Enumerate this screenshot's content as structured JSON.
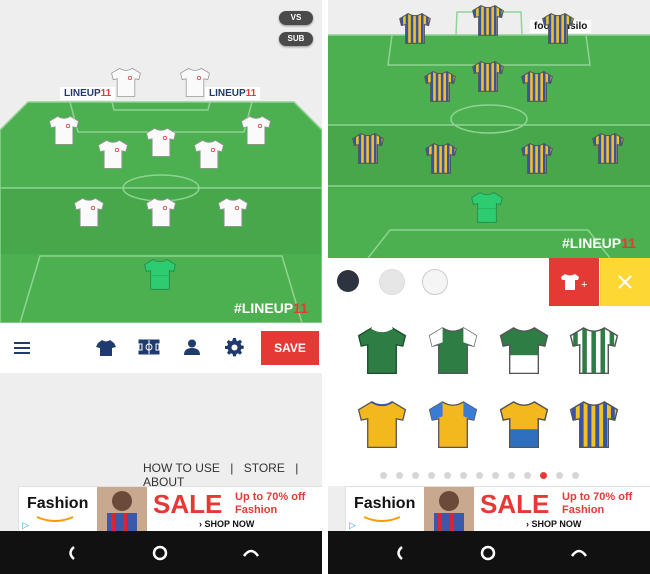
{
  "left": {
    "vs_label": "VS",
    "sub_label": "SUB",
    "label_left": "LINEUP",
    "label_left_num": "11",
    "label_right": "LINEUP",
    "label_right_num": "11",
    "watermark": "#LINEUP",
    "watermark_num": "11",
    "toolbar": {
      "save_label": "SAVE"
    },
    "footer_links": [
      "HOW TO USE",
      "STORE",
      "ABOUT"
    ]
  },
  "right": {
    "watermark": "#LINEUP",
    "watermark_num": "11",
    "header_label": "footballsilo",
    "kit_pager": {
      "pages": 13,
      "active": 10
    }
  },
  "ad": {
    "brand": "Fashion",
    "sale": "SALE",
    "offer": "Up to 70% off Fashion",
    "cta": "› SHOP NOW"
  },
  "colors": {
    "pitch": "#4caf50",
    "save": "#e53935",
    "close": "#fdd835",
    "add_kit": "#e53935"
  }
}
